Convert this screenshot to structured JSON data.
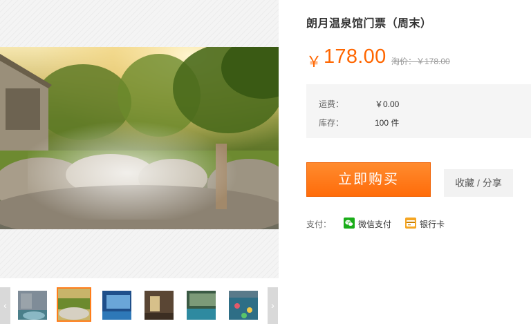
{
  "product": {
    "title": "朗月温泉馆门票（周末）",
    "currency_symbol": "￥",
    "price": "178.00",
    "original_price": "淘价：￥178.00"
  },
  "info": {
    "shipping_label": "运费：",
    "shipping_value": "￥0.00",
    "stock_label": "库存：",
    "stock_value": "100 件"
  },
  "actions": {
    "buy_label": "立即购买",
    "favorite_label": "收藏 / 分享"
  },
  "payment": {
    "label": "支付：",
    "methods": [
      {
        "name": "微信支付",
        "icon": "wechat-icon",
        "color": "#1aad19"
      },
      {
        "name": "银行卡",
        "icon": "bank-card-icon",
        "color": "#f5a623"
      }
    ]
  },
  "gallery": {
    "prev_arrow": "‹",
    "next_arrow": "›",
    "active_index": 1
  },
  "colors": {
    "accent": "#ff6600",
    "button": "#ff7a1a"
  }
}
